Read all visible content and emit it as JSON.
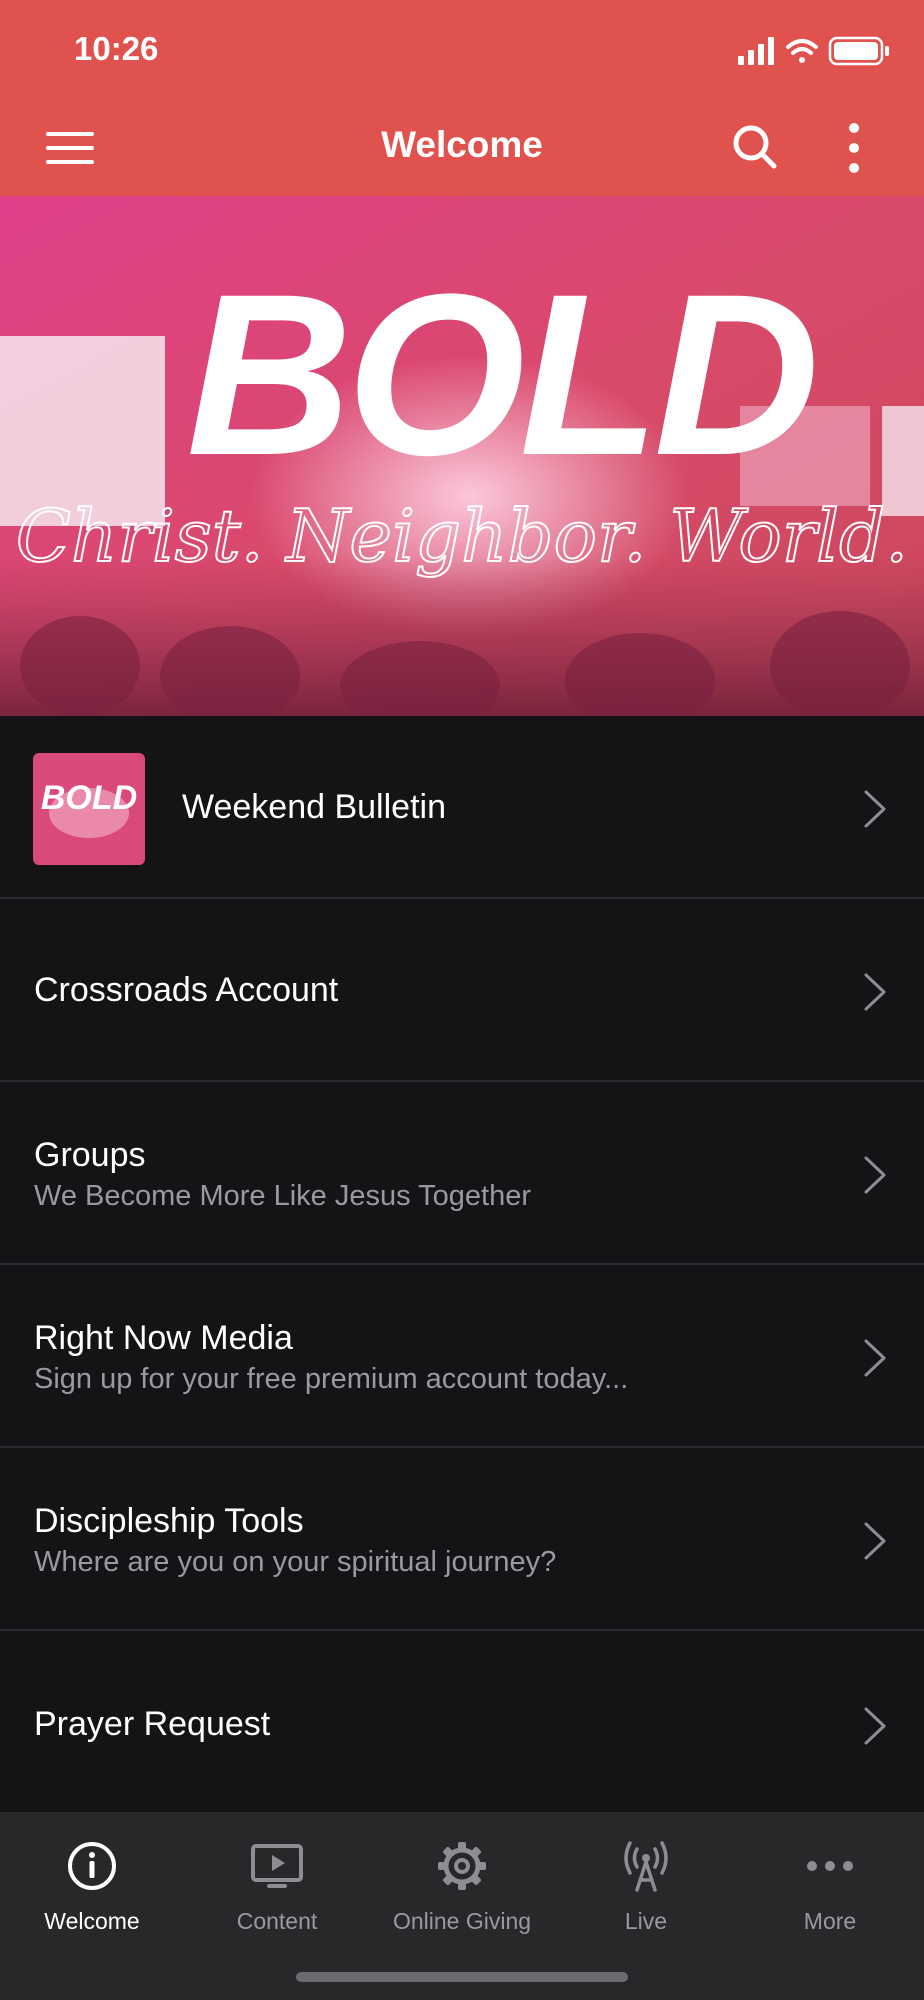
{
  "status_bar": {
    "time": "10:26"
  },
  "header": {
    "title": "Welcome",
    "menu_icon": "hamburger-menu-icon",
    "search_icon": "search-icon",
    "more_icon": "vertical-ellipsis-icon",
    "background_color": "#e0524e"
  },
  "hero": {
    "headline": "BOLD",
    "tagline": "Christ. Neighbor. World."
  },
  "list": {
    "items": [
      {
        "title": "Weekend Bulletin",
        "subtitle": "",
        "has_thumbnail": true,
        "thumbnail_text": "BOLD"
      },
      {
        "title": "Crossroads Account",
        "subtitle": ""
      },
      {
        "title": "Groups",
        "subtitle": "We Become More Like Jesus Together"
      },
      {
        "title": "Right Now Media",
        "subtitle": "Sign up for your free premium account today..."
      },
      {
        "title": "Discipleship Tools",
        "subtitle": "Where are you on your spiritual journey?"
      },
      {
        "title": "Prayer Request",
        "subtitle": ""
      }
    ]
  },
  "tab_bar": {
    "tabs": [
      {
        "label": "Welcome",
        "icon": "info-circle-icon",
        "active": true
      },
      {
        "label": "Content",
        "icon": "tv-play-icon",
        "active": false
      },
      {
        "label": "Online Giving",
        "icon": "gear-icon",
        "active": false
      },
      {
        "label": "Live",
        "icon": "broadcast-antenna-icon",
        "active": false
      },
      {
        "label": "More",
        "icon": "horizontal-ellipsis-icon",
        "active": false
      }
    ]
  }
}
